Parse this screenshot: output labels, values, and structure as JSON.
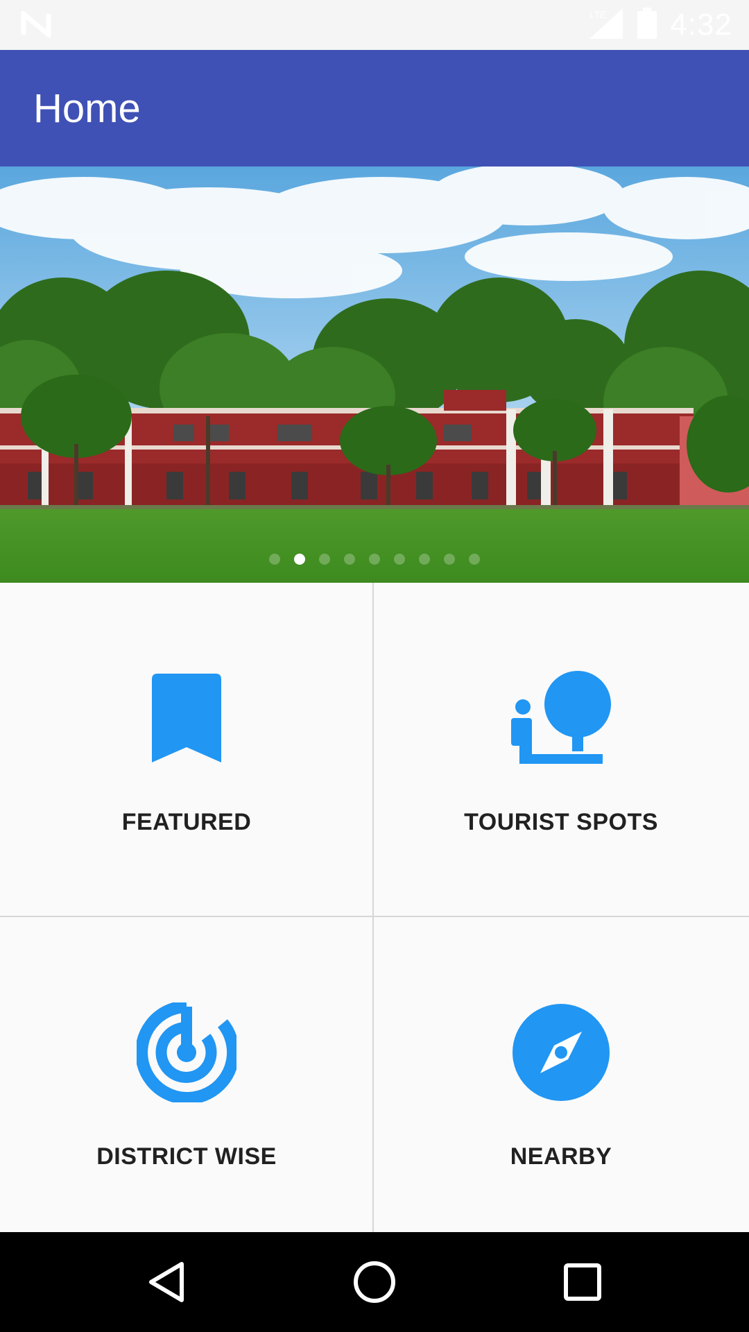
{
  "status_bar": {
    "time": "4:32",
    "network": "LTE",
    "icons": [
      "notification-n-icon",
      "signal-icon",
      "battery-icon"
    ]
  },
  "app_bar": {
    "title": "Home"
  },
  "carousel": {
    "page_count": 9,
    "active_index": 1
  },
  "tiles": [
    {
      "label": "FEATURED",
      "icon": "bookmark-icon"
    },
    {
      "label": "TOURIST SPOTS",
      "icon": "park-icon"
    },
    {
      "label": "DISTRICT WISE",
      "icon": "radar-icon"
    },
    {
      "label": "NEARBY",
      "icon": "compass-icon"
    }
  ],
  "nav_bar": {
    "buttons": [
      "back-icon",
      "home-icon",
      "recents-icon"
    ]
  },
  "colors": {
    "primary": "#3f51b5",
    "accent": "#2196f3",
    "background": "#fafafa"
  }
}
